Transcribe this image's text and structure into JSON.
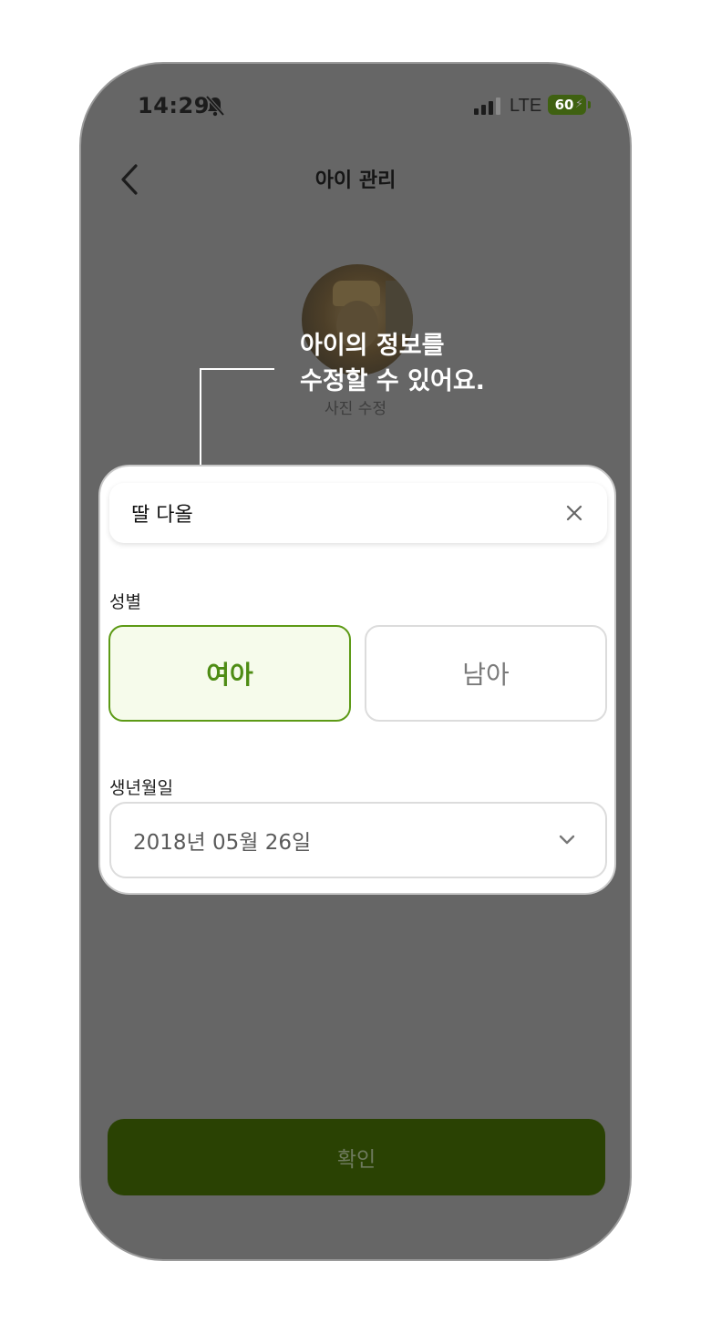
{
  "status_bar": {
    "time": "14:29",
    "network": "LTE",
    "battery": "60"
  },
  "header": {
    "title": "아이 관리",
    "back_icon": "chevron-left-icon"
  },
  "profile": {
    "photo_edit_label": "사진 수정"
  },
  "tooltip": {
    "line1": "아이의 정보를",
    "line2": "수정할 수 있어요."
  },
  "form": {
    "name_value": "딸 다올",
    "gender_label": "성별",
    "gender_options": [
      "여아",
      "남아"
    ],
    "gender_selected": "여아",
    "birth_label": "생년월일",
    "birth_value": "2018년 05월 26일"
  },
  "confirm_label": "확인",
  "colors": {
    "accent": "#5d9a16",
    "selected_bg": "#f6fbeb",
    "button_bg": "#2a4203",
    "overlay": "#666666"
  }
}
